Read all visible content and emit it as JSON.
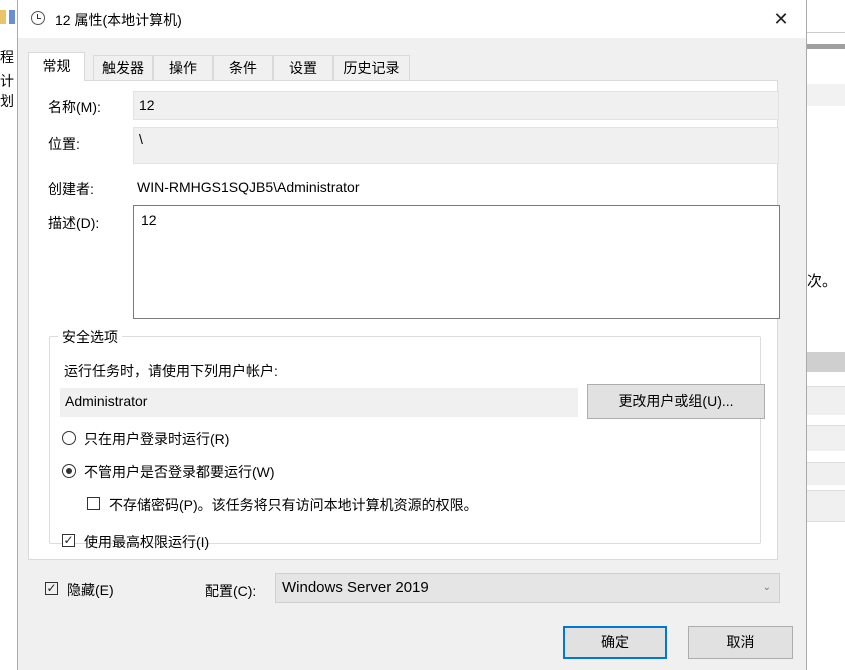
{
  "background": {
    "left_text_1": "程",
    "left_text_2": "计划",
    "right_text": "次。"
  },
  "dialog": {
    "title": "12 属性(本地计算机)",
    "close_glyph": "✕"
  },
  "tabs": [
    "常规",
    "触发器",
    "操作",
    "条件",
    "设置",
    "历史记录"
  ],
  "general": {
    "name_label": "名称(M):",
    "name_value": "12",
    "location_label": "位置:",
    "location_value": "\\",
    "author_label": "创建者:",
    "author_value": "WIN-RMHGS1SQJB5\\Administrator",
    "description_label": "描述(D):",
    "description_value": "12"
  },
  "security": {
    "group_title": "安全选项",
    "run_as_prompt": "运行任务时，请使用下列用户帐户:",
    "user_account": "Administrator",
    "change_user_button": "更改用户或组(U)...",
    "radio_logged_on": "只在用户登录时运行(R)",
    "radio_logged_on_selected": false,
    "radio_whether_logged_on": "不管用户是否登录都要运行(W)",
    "radio_whether_logged_on_selected": true,
    "do_not_store_password": "不存储密码(P)。该任务将只有访问本地计算机资源的权限。",
    "do_not_store_password_checked": false,
    "run_highest_privileges": "使用最高权限运行(I)",
    "run_highest_privileges_checked": true
  },
  "bottom": {
    "hidden_label": "隐藏(E)",
    "hidden_checked": true,
    "configure_label": "配置(C):",
    "configure_value": "Windows Server 2019"
  },
  "buttons": {
    "ok": "确定",
    "cancel": "取消"
  },
  "icons": {
    "title_icon": "clock-icon",
    "check_mark": "✓",
    "dropdown_arrow": "⌄"
  },
  "colors": {
    "accent": "#0078d7",
    "dialog_bg": "#f0f0f0",
    "panel_bg": "#ffffff"
  }
}
